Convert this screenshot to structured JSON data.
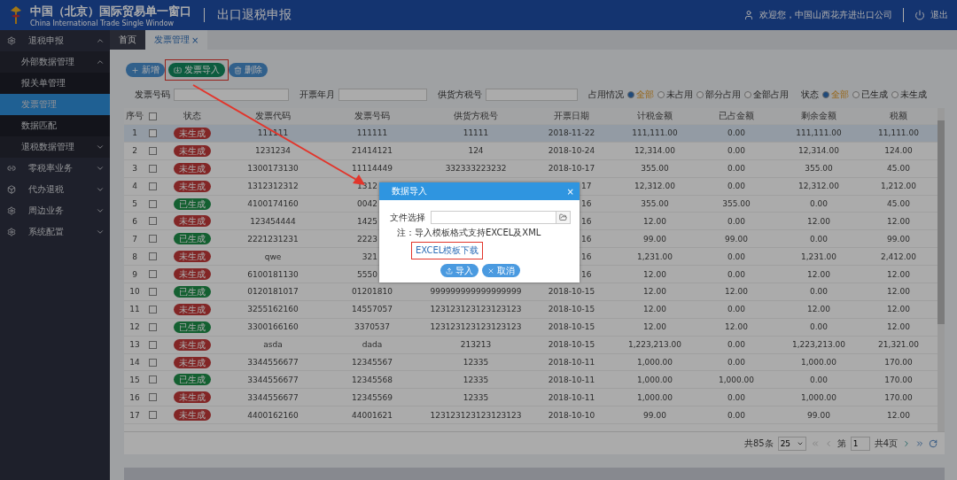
{
  "header": {
    "title": "中国（北京）国际贸易单一窗口",
    "subtitle": "China International Trade Single Window",
    "module": "出口退税申报",
    "welcome": "欢迎您，中国山西花卉进出口公司",
    "logout": "退出"
  },
  "sidebar": {
    "items": [
      {
        "label": "退税申报",
        "expanded": true,
        "children": [
          {
            "label": "外部数据管理",
            "expanded": true,
            "children": [
              {
                "label": "报关单管理",
                "selected": false
              },
              {
                "label": "发票管理",
                "selected": true
              },
              {
                "label": "数据匹配",
                "selected": false
              }
            ]
          },
          {
            "label": "退税数据管理",
            "expanded": false
          }
        ]
      },
      {
        "label": "零税率业务",
        "expanded": false
      },
      {
        "label": "代办退税",
        "expanded": false
      },
      {
        "label": "周边业务",
        "expanded": false
      },
      {
        "label": "系统配置",
        "expanded": false
      }
    ]
  },
  "tabs": [
    {
      "label": "首页",
      "selected": false
    },
    {
      "label": "发票管理",
      "selected": true,
      "close": "×"
    }
  ],
  "toolbar": [
    {
      "kind": "add",
      "label": "新增",
      "highlighted": false
    },
    {
      "kind": "import",
      "label": "发票导入",
      "highlighted": true
    },
    {
      "kind": "delete",
      "label": "删除",
      "highlighted": false
    }
  ],
  "filters": {
    "fields": [
      {
        "label": "发票号码"
      },
      {
        "label": "开票年月"
      },
      {
        "label": "供货方税号"
      }
    ],
    "radio_groups": [
      {
        "label": "占用情况",
        "options": [
          {
            "label": "全部",
            "selected": true
          },
          {
            "label": "未占用",
            "selected": false
          },
          {
            "label": "部分占用",
            "selected": false
          },
          {
            "label": "全部占用",
            "selected": false
          }
        ]
      },
      {
        "label": "状态",
        "options": [
          {
            "label": "全部",
            "selected": true
          },
          {
            "label": "已生成",
            "selected": false
          },
          {
            "label": "未生成",
            "selected": false
          }
        ]
      }
    ]
  },
  "table": {
    "columns": [
      "序号",
      {
        "kind": "checkbox",
        "checked": false
      },
      "状态",
      "发票代码",
      "发票号码",
      "供货方税号",
      "开票日期",
      "计税金额",
      "已占金额",
      "剩余金额",
      "税额"
    ],
    "rows": [
      {
        "selected": true,
        "obscured": false,
        "cells": [
          "1",
          {
            "kind": "checkbox",
            "checked": false
          },
          {
            "kind": "status",
            "label": "未生成",
            "generated": false
          },
          "111111",
          "111111",
          "11111",
          "2018-11-22",
          "111,111.00",
          "0.00",
          "111,111.00",
          "11,111.00"
        ]
      },
      {
        "selected": false,
        "obscured": false,
        "cells": [
          "2",
          {
            "kind": "checkbox",
            "checked": false
          },
          {
            "kind": "status",
            "label": "未生成",
            "generated": false
          },
          "1231234",
          "21414121",
          "124",
          "2018-10-24",
          "12,314.00",
          "0.00",
          "12,314.00",
          "124.00"
        ]
      },
      {
        "selected": false,
        "obscured": false,
        "cells": [
          "3",
          {
            "kind": "checkbox",
            "checked": false
          },
          {
            "kind": "status",
            "label": "未生成",
            "generated": false
          },
          "1300173130",
          "11114449",
          "332333223232",
          "2018-10-17",
          "355.00",
          "0.00",
          "355.00",
          "45.00"
        ]
      },
      {
        "selected": false,
        "obscured": true,
        "cells": [
          "4",
          {
            "kind": "checkbox",
            "checked": false
          },
          {
            "kind": "status",
            "label": "未生成",
            "generated": false
          },
          "1312312312",
          "1312",
          null,
          "17",
          "12,312.00",
          "0.00",
          "12,312.00",
          "1,212.00"
        ]
      },
      {
        "selected": false,
        "obscured": true,
        "cells": [
          "5",
          {
            "kind": "checkbox",
            "checked": false
          },
          {
            "kind": "status",
            "label": "已生成",
            "generated": true
          },
          "4100174160",
          "0042",
          null,
          "16",
          "355.00",
          "355.00",
          "0.00",
          "45.00"
        ]
      },
      {
        "selected": false,
        "obscured": true,
        "cells": [
          "6",
          {
            "kind": "checkbox",
            "checked": false
          },
          {
            "kind": "status",
            "label": "未生成",
            "generated": false
          },
          "123454444",
          "1425",
          null,
          "16",
          "12.00",
          "0.00",
          "12.00",
          "12.00"
        ]
      },
      {
        "selected": false,
        "obscured": true,
        "cells": [
          "7",
          {
            "kind": "checkbox",
            "checked": false
          },
          {
            "kind": "status",
            "label": "已生成",
            "generated": true
          },
          "2221231231",
          "2223",
          null,
          "16",
          "99.00",
          "99.00",
          "0.00",
          "99.00"
        ]
      },
      {
        "selected": false,
        "obscured": true,
        "cells": [
          "8",
          {
            "kind": "checkbox",
            "checked": false
          },
          {
            "kind": "status",
            "label": "未生成",
            "generated": false
          },
          "qwe",
          "321",
          null,
          "16",
          "1,231.00",
          "0.00",
          "1,231.00",
          "2,412.00"
        ]
      },
      {
        "selected": false,
        "obscured": true,
        "cells": [
          "9",
          {
            "kind": "checkbox",
            "checked": false
          },
          {
            "kind": "status",
            "label": "未生成",
            "generated": false
          },
          "6100181130",
          "5550",
          null,
          "16",
          "12.00",
          "0.00",
          "12.00",
          "12.00"
        ]
      },
      {
        "selected": false,
        "obscured": false,
        "cells": [
          "10",
          {
            "kind": "checkbox",
            "checked": false
          },
          {
            "kind": "status",
            "label": "已生成",
            "generated": true
          },
          "0120181017",
          "01201810",
          "999999999999999999",
          "2018-10-15",
          "12.00",
          "12.00",
          "0.00",
          "12.00"
        ]
      },
      {
        "selected": false,
        "obscured": false,
        "cells": [
          "11",
          {
            "kind": "checkbox",
            "checked": false
          },
          {
            "kind": "status",
            "label": "未生成",
            "generated": false
          },
          "3255162160",
          "14557057",
          "123123123123123123",
          "2018-10-15",
          "12.00",
          "0.00",
          "12.00",
          "12.00"
        ]
      },
      {
        "selected": false,
        "obscured": false,
        "cells": [
          "12",
          {
            "kind": "checkbox",
            "checked": false
          },
          {
            "kind": "status",
            "label": "已生成",
            "generated": true
          },
          "3300166160",
          "3370537",
          "123123123123123123",
          "2018-10-15",
          "12.00",
          "12.00",
          "0.00",
          "12.00"
        ]
      },
      {
        "selected": false,
        "obscured": false,
        "cells": [
          "13",
          {
            "kind": "checkbox",
            "checked": false
          },
          {
            "kind": "status",
            "label": "未生成",
            "generated": false
          },
          "asda",
          "dada",
          "213213",
          "2018-10-15",
          "1,223,213.00",
          "0.00",
          "1,223,213.00",
          "21,321.00"
        ]
      },
      {
        "selected": false,
        "obscured": false,
        "cells": [
          "14",
          {
            "kind": "checkbox",
            "checked": false
          },
          {
            "kind": "status",
            "label": "未生成",
            "generated": false
          },
          "3344556677",
          "12345567",
          "12335",
          "2018-10-11",
          "1,000.00",
          "0.00",
          "1,000.00",
          "170.00"
        ]
      },
      {
        "selected": false,
        "obscured": false,
        "cells": [
          "15",
          {
            "kind": "checkbox",
            "checked": false
          },
          {
            "kind": "status",
            "label": "已生成",
            "generated": true
          },
          "3344556677",
          "12345568",
          "12335",
          "2018-10-11",
          "1,000.00",
          "1,000.00",
          "0.00",
          "170.00"
        ]
      },
      {
        "selected": false,
        "obscured": false,
        "cells": [
          "16",
          {
            "kind": "checkbox",
            "checked": false
          },
          {
            "kind": "status",
            "label": "未生成",
            "generated": false
          },
          "3344556677",
          "12345569",
          "12335",
          "2018-10-11",
          "1,000.00",
          "0.00",
          "1,000.00",
          "170.00"
        ]
      },
      {
        "selected": false,
        "obscured": false,
        "cells": [
          "17",
          {
            "kind": "checkbox",
            "checked": false
          },
          {
            "kind": "status",
            "label": "未生成",
            "generated": false
          },
          "4400162160",
          "44001621",
          "123123123123123123",
          "2018-10-10",
          "99.00",
          "0.00",
          "99.00",
          "12.00"
        ]
      }
    ]
  },
  "pagination": {
    "total": "共85条",
    "page_size": "25",
    "page_label": "第",
    "page": "1",
    "pages": "共4页"
  },
  "dialog": {
    "title": "数据导入",
    "close": "×",
    "file_label": "文件选择",
    "note": "注：导入模板格式支持EXCEL及XML",
    "link": {
      "label": "EXCEL模板下载",
      "highlighted": true
    },
    "buttons": [
      {
        "kind": "import",
        "label": "导入"
      },
      {
        "kind": "cancel",
        "label": "取消"
      }
    ]
  },
  "annotation": {
    "arrow": true
  }
}
